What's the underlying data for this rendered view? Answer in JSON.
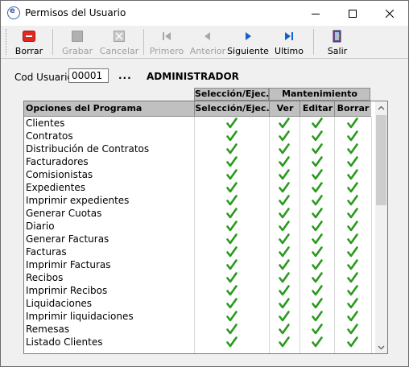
{
  "window": {
    "title": "Permisos del Usuario",
    "app_icon_letter": "e"
  },
  "toolbar": {
    "buttons": [
      {
        "label": "Borrar",
        "icon": "delete-icon",
        "enabled": true,
        "color": "#e0281e"
      },
      {
        "label": "Grabar",
        "icon": "save-icon",
        "enabled": false
      },
      {
        "label": "Cancelar",
        "icon": "cancel-icon",
        "enabled": false
      },
      {
        "label": "Primero",
        "icon": "first-icon",
        "enabled": false
      },
      {
        "label": "Anterior",
        "icon": "previous-icon",
        "enabled": false
      },
      {
        "label": "Siguiente",
        "icon": "next-icon",
        "enabled": true,
        "color": "#1560d0"
      },
      {
        "label": "Ultimo",
        "icon": "last-icon",
        "enabled": true,
        "color": "#1560d0"
      },
      {
        "label": "Salir",
        "icon": "exit-icon",
        "enabled": true
      }
    ]
  },
  "user": {
    "cod_label": "Cod Usuario",
    "cod_value": "00001",
    "lookup_label": "...",
    "name": "ADMINISTRADOR"
  },
  "grid": {
    "group_headers": [
      "Selección/Ejec.",
      "Mantenimiento"
    ],
    "columns": [
      "Opciones del Programa",
      "Selección/Ejec.",
      "Ver",
      "Editar",
      "Borrar"
    ],
    "check_color": "#2a9a1e",
    "rows": [
      {
        "option": "Clientes",
        "sel": true,
        "ver": true,
        "editar": true,
        "borrar": true
      },
      {
        "option": "Contratos",
        "sel": true,
        "ver": true,
        "editar": true,
        "borrar": true
      },
      {
        "option": "Distribución de Contratos",
        "sel": true,
        "ver": true,
        "editar": true,
        "borrar": true
      },
      {
        "option": "Facturadores",
        "sel": true,
        "ver": true,
        "editar": true,
        "borrar": true
      },
      {
        "option": "Comisionistas",
        "sel": true,
        "ver": true,
        "editar": true,
        "borrar": true
      },
      {
        "option": "Expedientes",
        "sel": true,
        "ver": true,
        "editar": true,
        "borrar": true
      },
      {
        "option": "Imprimir expedientes",
        "sel": true,
        "ver": true,
        "editar": true,
        "borrar": true
      },
      {
        "option": "Generar Cuotas",
        "sel": true,
        "ver": true,
        "editar": true,
        "borrar": true
      },
      {
        "option": "Diario",
        "sel": true,
        "ver": true,
        "editar": true,
        "borrar": true
      },
      {
        "option": "Generar Facturas",
        "sel": true,
        "ver": true,
        "editar": true,
        "borrar": true
      },
      {
        "option": "Facturas",
        "sel": true,
        "ver": true,
        "editar": true,
        "borrar": true
      },
      {
        "option": "Imprimir Facturas",
        "sel": true,
        "ver": true,
        "editar": true,
        "borrar": true
      },
      {
        "option": "Recibos",
        "sel": true,
        "ver": true,
        "editar": true,
        "borrar": true
      },
      {
        "option": "Imprimir Recibos",
        "sel": true,
        "ver": true,
        "editar": true,
        "borrar": true
      },
      {
        "option": "Liquidaciones",
        "sel": true,
        "ver": true,
        "editar": true,
        "borrar": true
      },
      {
        "option": "Imprimir liquidaciones",
        "sel": true,
        "ver": true,
        "editar": true,
        "borrar": true
      },
      {
        "option": "Remesas",
        "sel": true,
        "ver": true,
        "editar": true,
        "borrar": true
      },
      {
        "option": "Listado Clientes",
        "sel": true,
        "ver": true,
        "editar": true,
        "borrar": true
      }
    ]
  }
}
